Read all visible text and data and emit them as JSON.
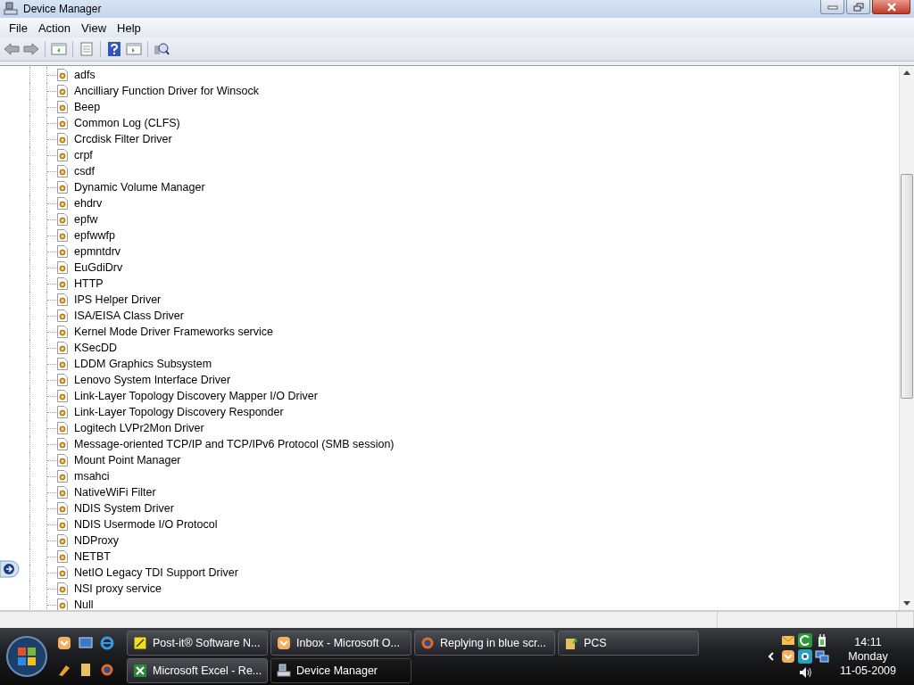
{
  "window": {
    "title": "Device Manager"
  },
  "menu": [
    "File",
    "Action",
    "View",
    "Help"
  ],
  "tree": {
    "items": [
      "adfs",
      "Ancilliary Function Driver for Winsock",
      "Beep",
      "Common Log (CLFS)",
      "Crcdisk Filter Driver",
      "crpf",
      "csdf",
      "Dynamic Volume Manager",
      "ehdrv",
      "epfw",
      "epfwwfp",
      "epmntdrv",
      "EuGdiDrv",
      "HTTP",
      "IPS Helper Driver",
      "ISA/EISA Class Driver",
      "Kernel Mode Driver Frameworks service",
      "KSecDD",
      "LDDM Graphics Subsystem",
      "Lenovo System Interface Driver",
      "Link-Layer Topology Discovery Mapper I/O Driver",
      "Link-Layer Topology Discovery Responder",
      "Logitech LVPr2Mon Driver",
      "Message-oriented TCP/IP and TCP/IPv6 Protocol (SMB session)",
      "Mount Point Manager",
      "msahci",
      "NativeWiFi Filter",
      "NDIS System Driver",
      "NDIS Usermode I/O Protocol",
      "NDProxy",
      "NETBT",
      "NetIO Legacy TDI Support Driver",
      "NSI proxy service",
      "Null"
    ]
  },
  "taskbar": {
    "buttons": [
      {
        "label": "Post-it® Software N...",
        "kind": "postit",
        "selected": false
      },
      {
        "label": "Inbox - Microsoft O...",
        "kind": "mail",
        "selected": false
      },
      {
        "label": "Replying in blue scr...",
        "kind": "browser",
        "selected": false
      },
      {
        "label": "PCS",
        "kind": "folder",
        "selected": false
      },
      {
        "label": "Microsoft Excel - Re...",
        "kind": "excel",
        "selected": false
      },
      {
        "label": "Device Manager",
        "kind": "device",
        "selected": true
      }
    ],
    "clock": {
      "time": "14:11",
      "day": "Monday",
      "date": "11-05-2009"
    }
  }
}
